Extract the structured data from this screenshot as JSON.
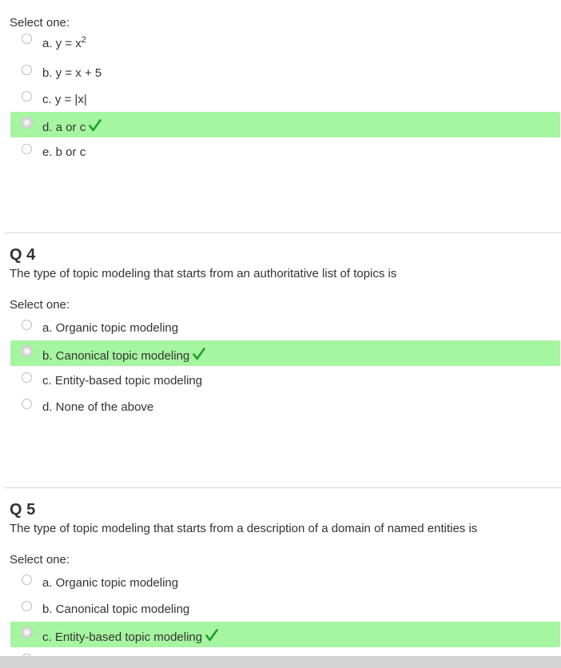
{
  "q3": {
    "select_label": "Select one:",
    "options": [
      {
        "prefix": "a. y = x",
        "sup": "2"
      },
      {
        "label": "b. y = x + 5"
      },
      {
        "label": "c. y = |x|"
      },
      {
        "label": "d. a or c",
        "selected": true,
        "correct": true
      },
      {
        "label": "e. b or c"
      }
    ]
  },
  "q4": {
    "number": "Q 4",
    "text": "The type of topic modeling that starts from an authoritative list of topics is",
    "select_label": "Select one:",
    "options": [
      {
        "label": "a. Organic topic modeling"
      },
      {
        "label": "b. Canonical topic modeling",
        "selected": true,
        "correct": true
      },
      {
        "label": "c. Entity-based topic modeling"
      },
      {
        "label": "d. None of the above"
      }
    ]
  },
  "q5": {
    "number": "Q 5",
    "text": "The type of topic modeling that starts from a description of a domain of named entities is",
    "select_label": "Select one:",
    "options": [
      {
        "label": "a. Organic topic modeling"
      },
      {
        "label": "b. Canonical topic modeling"
      },
      {
        "label": "c. Entity-based topic modeling",
        "selected": true,
        "correct": true
      }
    ]
  },
  "colors": {
    "correct_bg": "#a6f5a0",
    "check": "#1e9e2a",
    "divider": "#d9d9d9"
  },
  "icons": {
    "correct": "check-icon",
    "radio": "radio-icon"
  }
}
